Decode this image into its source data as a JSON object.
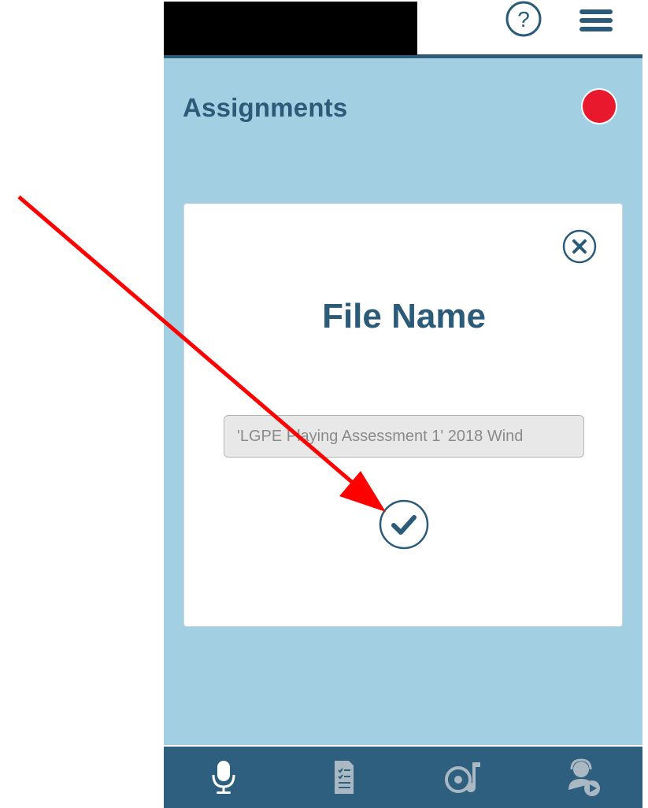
{
  "header": {
    "help_icon": "help-question-icon",
    "menu_icon": "hamburger-menu-icon"
  },
  "page": {
    "title": "Assignments",
    "record_indicator_color": "#e8192c"
  },
  "dialog": {
    "title": "File Name",
    "filename_value": "'LGPE Playing Assessment 1' 2018 Wind",
    "close_icon": "close-circle-icon",
    "confirm_icon": "checkmark-circle-icon"
  },
  "bottom_nav": {
    "tabs": [
      {
        "icon": "microphone-icon"
      },
      {
        "icon": "checklist-document-icon"
      },
      {
        "icon": "music-disc-icon"
      },
      {
        "icon": "user-headset-play-icon"
      }
    ]
  },
  "colors": {
    "primary": "#2b5b78",
    "background": "#a3cfe3",
    "nav_bar": "#2f5f7f",
    "annotation_arrow": "#ff0000"
  }
}
